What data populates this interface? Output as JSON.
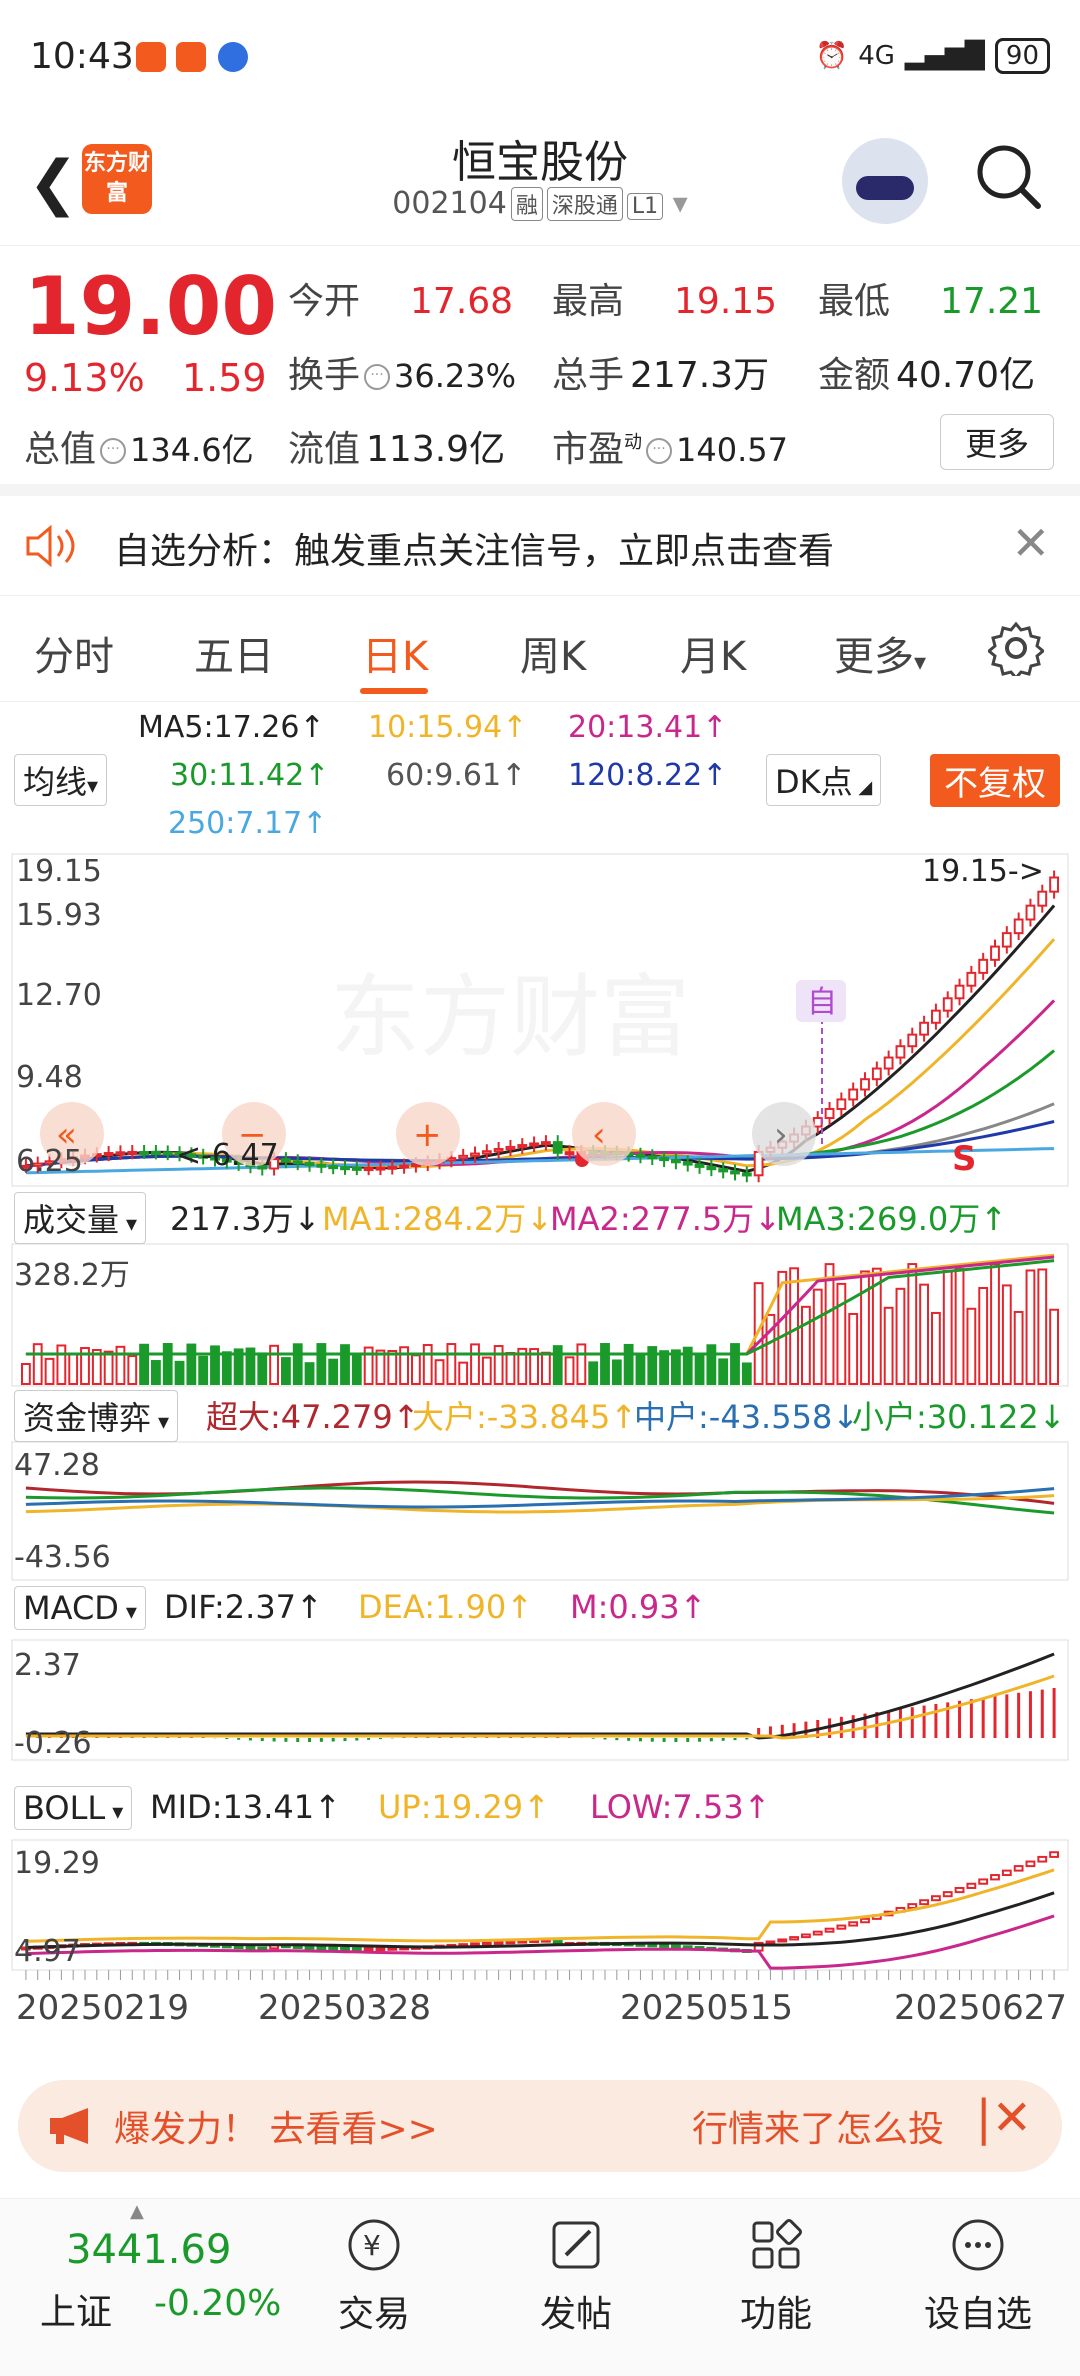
{
  "status": {
    "time": "10:43",
    "network": "4G",
    "battery": "90"
  },
  "header": {
    "logo_text": "东方财富",
    "title": "恒宝股份",
    "code": "002104",
    "tags": [
      "融",
      "深股通",
      "L1"
    ]
  },
  "quote": {
    "price": "19.00",
    "pct": "9.13%",
    "change": "1.59",
    "open_label": "今开",
    "open": "17.68",
    "high_label": "最高",
    "high": "19.15",
    "low_label": "最低",
    "low": "17.21",
    "turnover_label": "换手",
    "turnover": "36.23%",
    "volume_label": "总手",
    "volume": "217.3万",
    "amount_label": "金额",
    "amount": "40.70亿",
    "mktcap_label": "总值",
    "mktcap": "134.6亿",
    "float_label": "流值",
    "float": "113.9亿",
    "pe_label": "市盈",
    "pe_sup": "动",
    "pe": "140.57",
    "more": "更多"
  },
  "notice": {
    "text": "自选分析：触发重点关注信号，立即点击查看"
  },
  "tabs": [
    "分时",
    "五日",
    "日K",
    "周K",
    "月K",
    "更多"
  ],
  "active_tab": "日K",
  "ma": {
    "selector": "均线",
    "ma5": "MA5:17.26↑",
    "ma10": "10:15.94↑",
    "ma20": "20:13.41↑",
    "ma30": "30:11.42↑",
    "ma60": "60:9.61↑",
    "ma120": "120:8.22↑",
    "ma250": "250:7.17↑",
    "dk": "DK点",
    "fq": "不复权"
  },
  "kline": {
    "axis": [
      "19.15",
      "15.93",
      "12.70",
      "9.48",
      "6.25"
    ],
    "high_marker": "19.15->",
    "low_marker": "<-6.47",
    "zi_marker": "自",
    "s_marker": "S"
  },
  "volume": {
    "selector": "成交量",
    "value": "217.3万↓",
    "ma1": "MA1:284.2万↓",
    "ma2": "MA2:277.5万↓",
    "ma3": "MA3:269.0万↑",
    "axis_top": "328.2万"
  },
  "fund": {
    "selector": "资金博弈",
    "super": "超大:47.279↑",
    "big": "大户:-33.845↑",
    "mid": "中户:-43.558↓",
    "small": "小户:30.122↓",
    "axis_top": "47.28",
    "axis_bottom": "-43.56"
  },
  "macd": {
    "selector": "MACD",
    "dif": "DIF:2.37↑",
    "dea": "DEA:1.90↑",
    "m": "M:0.93↑",
    "axis_top": "2.37",
    "axis_bottom": "-0.26"
  },
  "boll": {
    "selector": "BOLL",
    "mid": "MID:13.41↑",
    "up": "UP:19.29↑",
    "low": "LOW:7.53↑",
    "axis_top": "19.29",
    "axis_bottom": "4.97"
  },
  "dates": [
    "20250219",
    "20250328",
    "20250515",
    "20250627"
  ],
  "banner": {
    "left": "爆发力！ 去看看>>",
    "right": "行情来了怎么投"
  },
  "bottom": {
    "index_value": "3441.69",
    "index_name": "上证",
    "index_pct": "-0.20%",
    "nav": [
      "交易",
      "发帖",
      "功能",
      "设自选"
    ]
  },
  "colors": {
    "up": "#e3262d",
    "down": "#1a9a2a",
    "accent": "#f25a1e"
  }
}
